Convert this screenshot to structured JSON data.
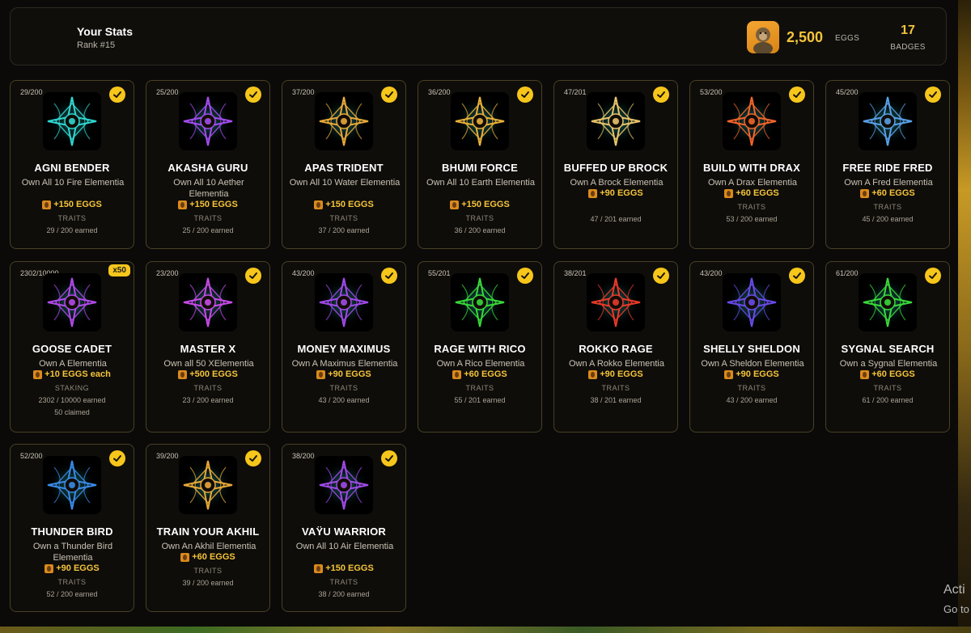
{
  "stats": {
    "title": "Your Stats",
    "rank": "Rank #15",
    "eggs_value": "2,500",
    "eggs_label": "EGGS",
    "badges_value": "17",
    "badges_label": "BADGES"
  },
  "badges": [
    {
      "count": "29/200",
      "name": "AGNI BENDER",
      "desc": "Own All 10 Fire Elementia",
      "reward": "+150 EGGS",
      "category": "TRAITS",
      "earned": "29 / 200 earned",
      "color": "#2fd6d0",
      "completed": true
    },
    {
      "count": "25/200",
      "name": "AKASHA GURU",
      "desc": "Own All 10 Aether Elementia",
      "reward": "+150 EGGS",
      "category": "TRAITS",
      "earned": "25 / 200 earned",
      "color": "#a34cf0",
      "completed": true
    },
    {
      "count": "37/200",
      "name": "APAS TRIDENT",
      "desc": "Own All 10 Water Elementia",
      "reward": "+150 EGGS",
      "category": "TRAITS",
      "earned": "37 / 200 earned",
      "color": "#e8a93a",
      "completed": true
    },
    {
      "count": "36/200",
      "name": "BHUMI FORCE",
      "desc": "Own All 10 Earth Elementia",
      "reward": "+150 EGGS",
      "category": "TRAITS",
      "earned": "36 / 200 earned",
      "color": "#e8b03a",
      "completed": true
    },
    {
      "count": "47/201",
      "name": "BUFFED UP BROCK",
      "desc": "Own A Brock Elementia",
      "reward": "+90 EGGS",
      "category": "",
      "earned": "47 / 201 earned",
      "color": "#e8c46a",
      "completed": true
    },
    {
      "count": "53/200",
      "name": "BUILD WITH DRAX",
      "desc": "Own A Drax Elementia",
      "reward": "+60 EGGS",
      "category": "TRAITS",
      "earned": "53 / 200 earned",
      "color": "#f0652a",
      "completed": true
    },
    {
      "count": "45/200",
      "name": "FREE RIDE FRED",
      "desc": "Own A Fred Elementia",
      "reward": "+60 EGGS",
      "category": "TRAITS",
      "earned": "45 / 200 earned",
      "color": "#5aa0e8",
      "completed": true
    },
    {
      "count": "2302/10000",
      "name": "GOOSE CADET",
      "desc": "Own A Elementia",
      "reward": "+10 EGGS each",
      "category": "STAKING",
      "earned": "2302 / 10000 earned",
      "claimed": "50 claimed",
      "multiplier": "x50",
      "color": "#b04ae8",
      "completed": false
    },
    {
      "count": "23/200",
      "name": "MASTER X",
      "desc": "Own all 50 XElementia",
      "reward": "+500 EGGS",
      "category": "TRAITS",
      "earned": "23 / 200 earned",
      "color": "#c84ae8",
      "completed": true
    },
    {
      "count": "43/200",
      "name": "MONEY MAXIMUS",
      "desc": "Own A Maximus Elementia",
      "reward": "+90 EGGS",
      "category": "TRAITS",
      "earned": "43 / 200 earned",
      "color": "#a04ae8",
      "completed": true
    },
    {
      "count": "55/201",
      "name": "RAGE WITH RICO",
      "desc": "Own A Rico Elementia",
      "reward": "+60 EGGS",
      "category": "TRAITS",
      "earned": "55 / 201 earned",
      "color": "#3ad83a",
      "completed": true
    },
    {
      "count": "38/201",
      "name": "ROKKO RAGE",
      "desc": "Own A Rokko Elementia",
      "reward": "+90 EGGS",
      "category": "TRAITS",
      "earned": "38 / 201 earned",
      "color": "#e83a2a",
      "completed": true
    },
    {
      "count": "43/200",
      "name": "SHELLY SHELDON",
      "desc": "Own A Sheldon Elementia",
      "reward": "+90 EGGS",
      "category": "TRAITS",
      "earned": "43 / 200 earned",
      "color": "#6a4ae8",
      "completed": true
    },
    {
      "count": "61/200",
      "name": "SYGNAL SEARCH",
      "desc": "Own a Sygnal Elementia",
      "reward": "+60 EGGS",
      "category": "TRAITS",
      "earned": "61 / 200 earned",
      "color": "#3ad83a",
      "completed": true
    },
    {
      "count": "52/200",
      "name": "THUNDER BIRD",
      "desc": "Own a Thunder Bird Elementia",
      "reward": "+90 EGGS",
      "category": "TRAITS",
      "earned": "52 / 200 earned",
      "color": "#3a8ae8",
      "completed": true
    },
    {
      "count": "39/200",
      "name": "TRAIN YOUR AKHIL",
      "desc": "Own An Akhil Elementia",
      "reward": "+60 EGGS",
      "category": "TRAITS",
      "earned": "39 / 200 earned",
      "color": "#e8a93a",
      "completed": true
    },
    {
      "count": "38/200",
      "name": "VAŸU WARRIOR",
      "desc": "Own All 10 Air Elementia",
      "reward": "+150 EGGS",
      "category": "TRAITS",
      "earned": "38 / 200 earned",
      "color": "#a04ae8",
      "completed": true
    }
  ],
  "watermark": {
    "line1": "Acti",
    "line2": "Go to"
  }
}
